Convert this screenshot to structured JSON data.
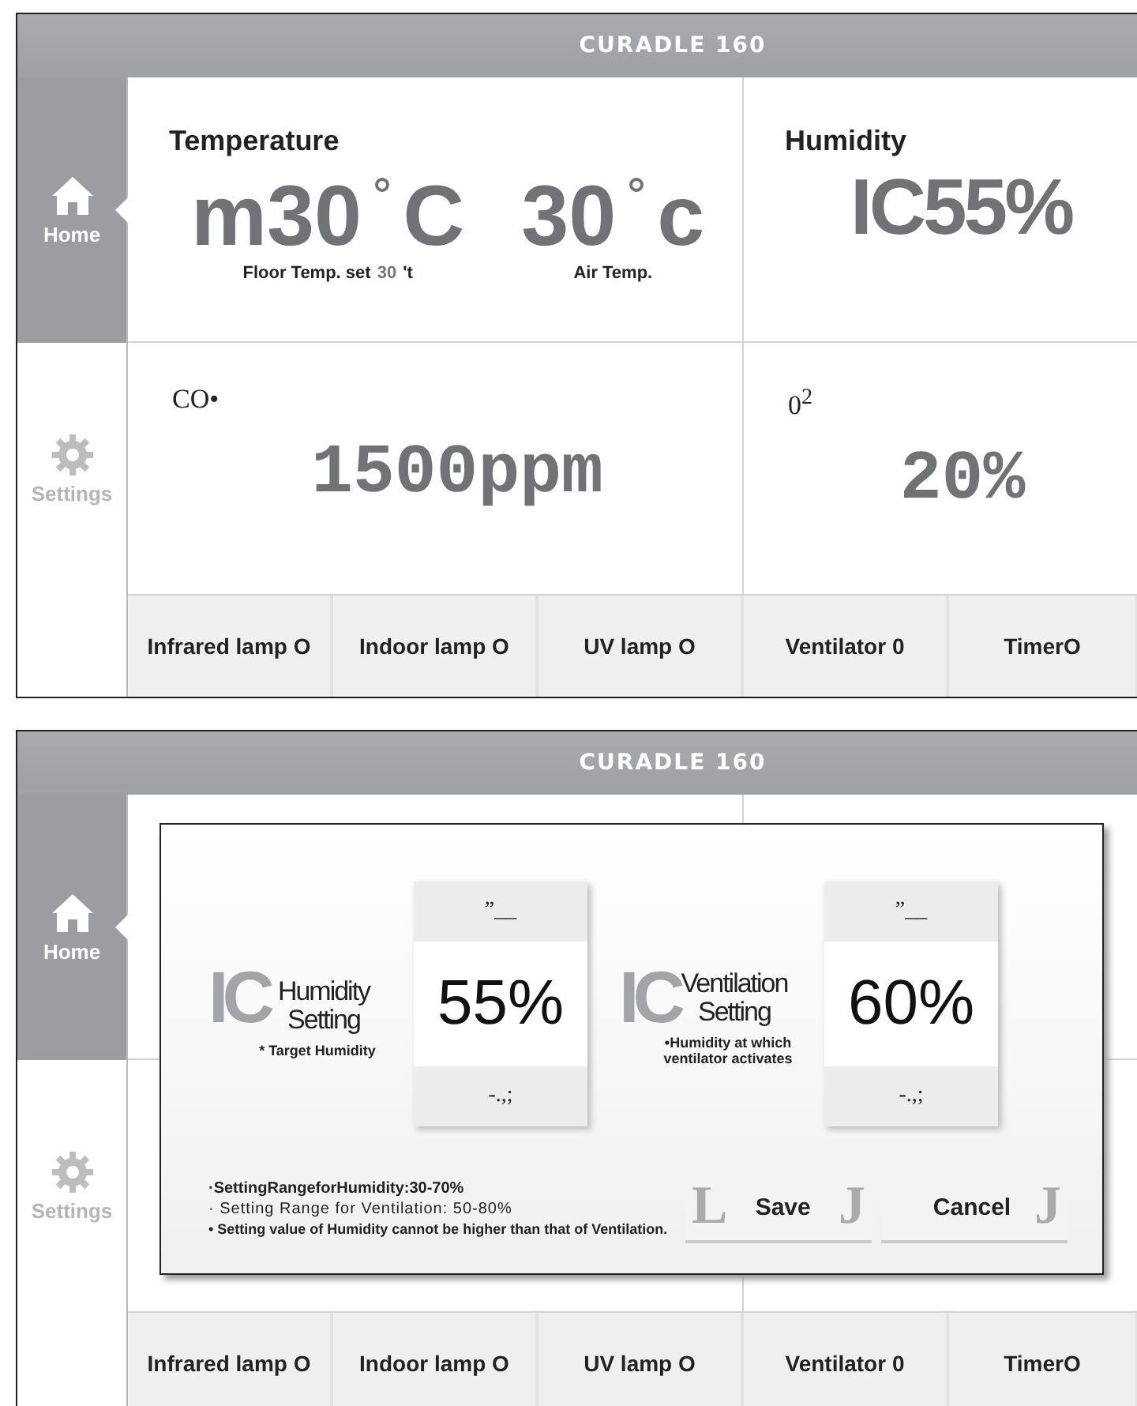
{
  "screens": [
    {
      "header": {
        "title": "CURADLE 160"
      },
      "sidebar": [
        {
          "label": "Home",
          "selected": true
        },
        {
          "label": "Settings",
          "selected": false
        }
      ],
      "cards": [
        {
          "kind": "temperature",
          "title": "Temperature",
          "readings": [
            {
              "value": "m30",
              "unit": "C",
              "caption": "Floor Temp. set",
              "caption_value": "30",
              "caption_suffix": "'t"
            },
            {
              "value": "30",
              "unit": "c",
              "caption": "Air Temp."
            }
          ]
        },
        {
          "kind": "simple",
          "title": "Humidity",
          "value": "IC55%"
        },
        {
          "kind": "mono",
          "title": "CO•",
          "value": "1500ppm"
        },
        {
          "kind": "mono",
          "title": "0$^{2}$",
          "value": "20%"
        }
      ],
      "controls": [
        {
          "label": "Infrared lamp O"
        },
        {
          "label": "Indoor lamp O"
        },
        {
          "label": "UV lamp O"
        },
        {
          "label": "Ventilator 0"
        },
        {
          "label": "TimerO"
        }
      ]
    },
    {
      "header": {
        "title": "CURADLE 160"
      },
      "sidebar": [
        {
          "label": "Home",
          "selected": true
        },
        {
          "label": "Settings",
          "selected": false
        }
      ],
      "controls": [
        {
          "label": "Infrared lamp O"
        },
        {
          "label": "Indoor lamp O"
        },
        {
          "label": "UV lamp O"
        },
        {
          "label": "Ventilator 0"
        },
        {
          "label": "TimerO"
        }
      ],
      "dialog": {
        "settings": [
          {
            "mark": "IC",
            "title": [
              "Humidity",
              "Setting"
            ],
            "note": "* Target Humidity",
            "up": "”__",
            "value": "55%",
            "down": "-.,;"
          },
          {
            "mark": "IC",
            "title": [
              "Ventilation",
              "Setting"
            ],
            "note": "•Humidity at which ventilator activates",
            "up": "”__",
            "value": "60%",
            "down": "-.,;"
          }
        ],
        "notes": [
          "·SettingRangeforHumidity:30-70%",
          "· Setting Range for Ventilation: 50-80%",
          "• Setting value of Humidity cannot be higher than that of Ventilation."
        ],
        "buttons": [
          {
            "label": "Save",
            "left_mark": "L",
            "right_mark": "J"
          },
          {
            "label": "Cancel",
            "right_mark": "J"
          }
        ]
      }
    }
  ]
}
